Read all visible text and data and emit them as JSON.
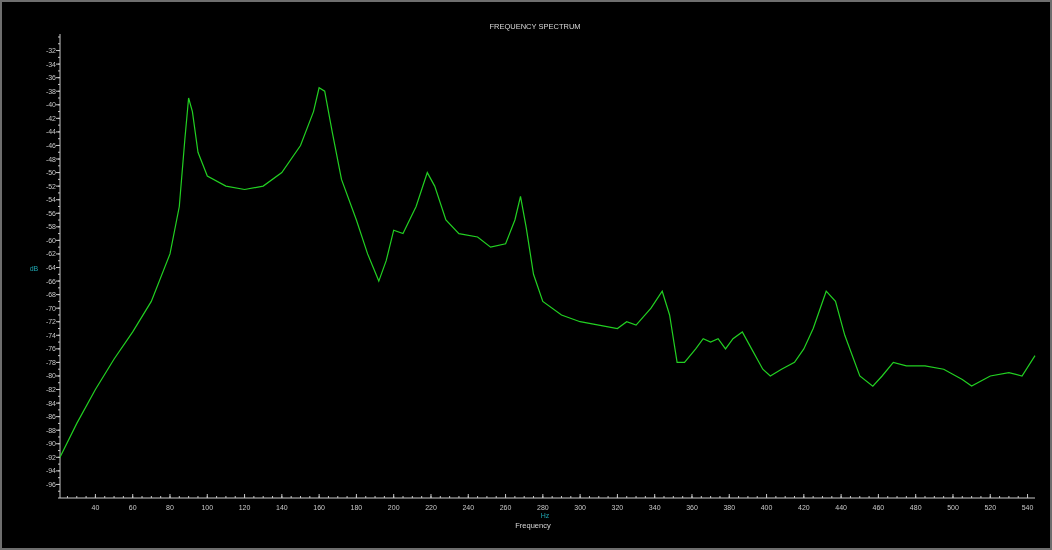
{
  "chart": {
    "x_unit": "Hz",
    "chart_data": {
      "type": "line",
      "title": "FREQUENCY SPECTRUM",
      "xlabel": "Frequency",
      "ylabel": "dB",
      "xlim": [
        21,
        544
      ],
      "ylim": [
        -98,
        -30
      ],
      "xticks": [
        40,
        60,
        80,
        100,
        120,
        140,
        160,
        180,
        200,
        220,
        240,
        260,
        280,
        300,
        320,
        340,
        360,
        380,
        400,
        420,
        440,
        460,
        480,
        500,
        520,
        540
      ],
      "yticks": [
        -32,
        -34,
        -36,
        -38,
        -40,
        -42,
        -44,
        -46,
        -48,
        -50,
        -52,
        -54,
        -56,
        -58,
        -60,
        -62,
        -64,
        -66,
        -68,
        -70,
        -72,
        -74,
        -76,
        -78,
        -80,
        -82,
        -84,
        -86,
        -88,
        -90,
        -92,
        -94,
        -96
      ],
      "x": [
        21,
        30,
        40,
        50,
        60,
        70,
        80,
        85,
        88,
        90,
        92,
        95,
        100,
        110,
        120,
        130,
        140,
        150,
        157,
        160,
        163,
        167,
        172,
        180,
        186,
        192,
        196,
        200,
        205,
        212,
        218,
        222,
        228,
        235,
        245,
        252,
        260,
        265,
        268,
        271,
        275,
        280,
        290,
        300,
        310,
        320,
        325,
        330,
        338,
        344,
        348,
        352,
        356,
        362,
        366,
        370,
        374,
        378,
        382,
        387,
        392,
        398,
        402,
        408,
        415,
        420,
        425,
        432,
        437,
        442,
        450,
        457,
        462,
        468,
        475,
        485,
        495,
        505,
        510,
        520,
        530,
        537,
        544
      ],
      "series": [
        {
          "color": "#22d022",
          "values": [
            -92,
            -87,
            -82,
            -77.5,
            -73.5,
            -69,
            -62,
            -55,
            -45,
            -39,
            -41,
            -47,
            -50.5,
            -52,
            -52.5,
            -52,
            -50,
            -46,
            -41,
            -37.5,
            -38,
            -44,
            -51,
            -57,
            -62,
            -66,
            -63,
            -58.5,
            -59,
            -55,
            -50,
            -52,
            -57,
            -59,
            -59.5,
            -61,
            -60.5,
            -57,
            -53.5,
            -58,
            -65,
            -69,
            -71,
            -72,
            -72.5,
            -73,
            -72,
            -72.5,
            -70,
            -67.5,
            -71,
            -78,
            -78,
            -76,
            -74.5,
            -75,
            -74.5,
            -76,
            -74.5,
            -73.5,
            -76,
            -79,
            -80,
            -79,
            -78,
            -76,
            -73,
            -67.5,
            -69,
            -74,
            -80,
            -81.5,
            -80,
            -78,
            -78.5,
            -78.5,
            -79,
            -80.5,
            -81.5,
            -80,
            -79.5,
            -80,
            -77
          ]
        }
      ]
    }
  }
}
